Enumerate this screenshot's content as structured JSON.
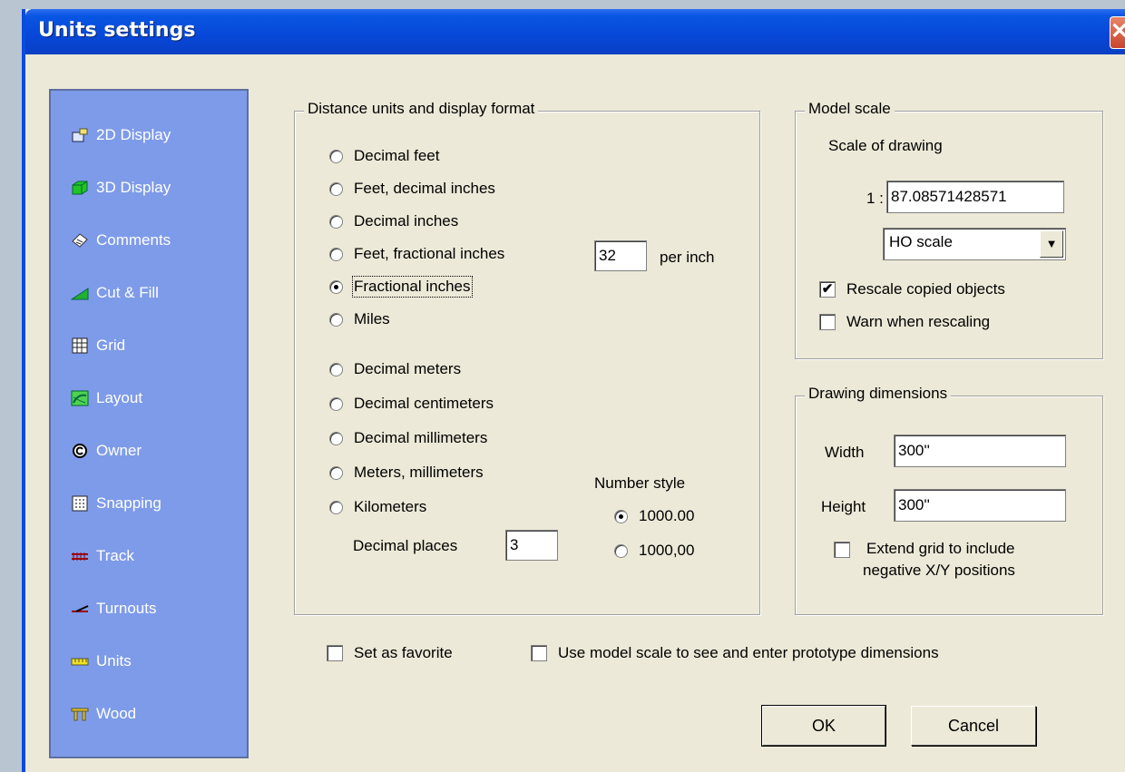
{
  "window": {
    "title": "Units settings",
    "close_glyph": "✕"
  },
  "sidebar": {
    "items": [
      {
        "label": "2D Display",
        "icon": "2d-display-icon"
      },
      {
        "label": "3D Display",
        "icon": "3d-display-icon"
      },
      {
        "label": "Comments",
        "icon": "comments-icon"
      },
      {
        "label": "Cut & Fill",
        "icon": "cut-fill-icon"
      },
      {
        "label": "Grid",
        "icon": "grid-icon"
      },
      {
        "label": "Layout",
        "icon": "layout-icon"
      },
      {
        "label": "Owner",
        "icon": "owner-icon"
      },
      {
        "label": "Snapping",
        "icon": "snapping-icon"
      },
      {
        "label": "Track",
        "icon": "track-icon"
      },
      {
        "label": "Turnouts",
        "icon": "turnouts-icon"
      },
      {
        "label": "Units",
        "icon": "units-icon"
      },
      {
        "label": "Wood",
        "icon": "wood-icon"
      }
    ]
  },
  "distance": {
    "legend": "Distance units and display format",
    "options": [
      "Decimal feet",
      "Feet, decimal inches",
      "Decimal inches",
      "Feet, fractional inches",
      "Fractional inches",
      "Miles",
      "Decimal meters",
      "Decimal centimeters",
      "Decimal millimeters",
      "Meters, millimeters",
      "Kilometers"
    ],
    "selected": "Fractional inches",
    "per_inch_value": "32",
    "per_inch_label": "per inch",
    "decimal_places_label": "Decimal places",
    "decimal_places_value": "3",
    "number_style_label": "Number style",
    "number_style_options": [
      "1000.00",
      "1000,00"
    ],
    "number_style_selected": "1000.00"
  },
  "model_scale": {
    "legend": "Model scale",
    "scale_label": "Scale of drawing",
    "ratio_prefix": "1 :",
    "ratio_value": "87.08571428571",
    "scale_select": "HO scale",
    "rescale_copied_label": "Rescale copied objects",
    "rescale_copied_checked": true,
    "warn_rescaling_label": "Warn when rescaling",
    "warn_rescaling_checked": false
  },
  "drawing_dimensions": {
    "legend": "Drawing dimensions",
    "width_label": "Width",
    "width_value": "300''",
    "height_label": "Height",
    "height_value": "300''",
    "extend_grid_label_1": "Extend grid to include",
    "extend_grid_label_2": "negative X/Y positions",
    "extend_grid_checked": false
  },
  "footer": {
    "favorite_label": "Set as favorite",
    "favorite_checked": false,
    "prototype_label": "Use model scale to see and enter prototype dimensions",
    "prototype_checked": false,
    "ok_label": "OK",
    "cancel_label": "Cancel"
  }
}
